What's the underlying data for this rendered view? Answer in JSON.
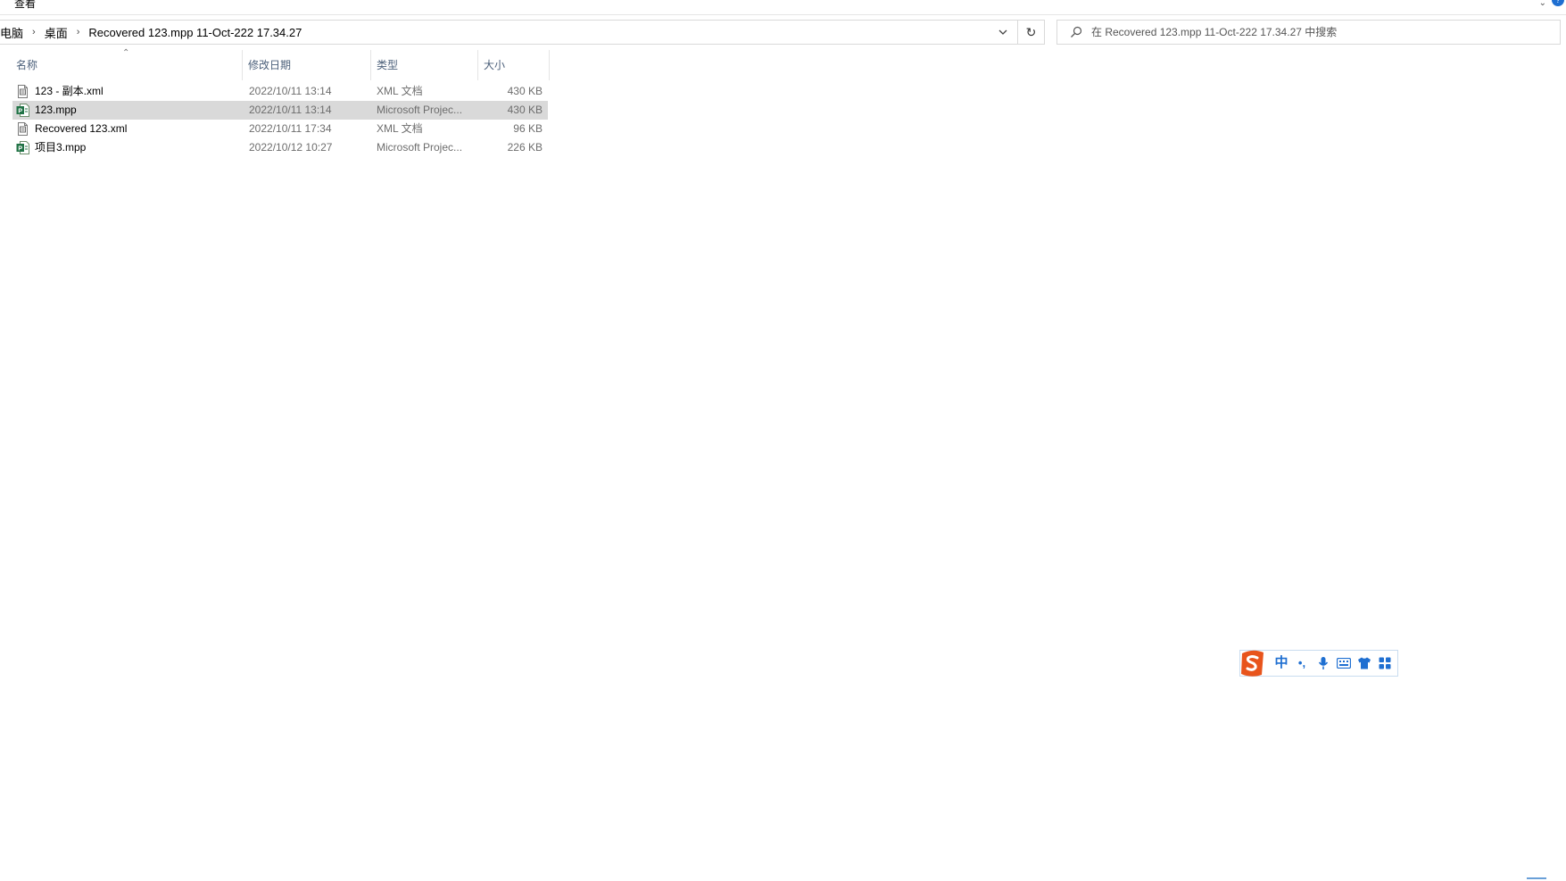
{
  "ribbon": {
    "tab_label": "查看",
    "help_glyph": "?"
  },
  "address": {
    "crumbs": [
      "电脑",
      "桌面",
      "Recovered 123.mpp 11-Oct-222 17.34.27"
    ]
  },
  "search": {
    "placeholder": "在 Recovered 123.mpp 11-Oct-222 17.34.27 中搜索"
  },
  "columns": {
    "name": "名称",
    "date": "修改日期",
    "type": "类型",
    "size": "大小"
  },
  "files": [
    {
      "name": "123 - 副本.xml",
      "date": "2022/10/11 13:14",
      "type": "XML 文档",
      "size": "430 KB",
      "icon": "xml-file-icon",
      "selected": false
    },
    {
      "name": "123.mpp",
      "date": "2022/10/11 13:14",
      "type": "Microsoft Projec...",
      "size": "430 KB",
      "icon": "project-file-icon",
      "selected": true
    },
    {
      "name": "Recovered 123.xml",
      "date": "2022/10/11 17:34",
      "type": "XML 文档",
      "size": "96 KB",
      "icon": "xml-file-icon",
      "selected": false
    },
    {
      "name": "项目3.mpp",
      "date": "2022/10/12 10:27",
      "type": "Microsoft Projec...",
      "size": "226 KB",
      "icon": "project-file-icon",
      "selected": false
    }
  ],
  "ime": {
    "lang_label": "中",
    "punct_label": "•,",
    "accent_color": "#1f6fd1",
    "logo_color": "#e8541c"
  },
  "colors": {
    "selection": "#d9d9d9",
    "header_text": "#4c607a",
    "secondary_text": "#6d6d6d"
  }
}
